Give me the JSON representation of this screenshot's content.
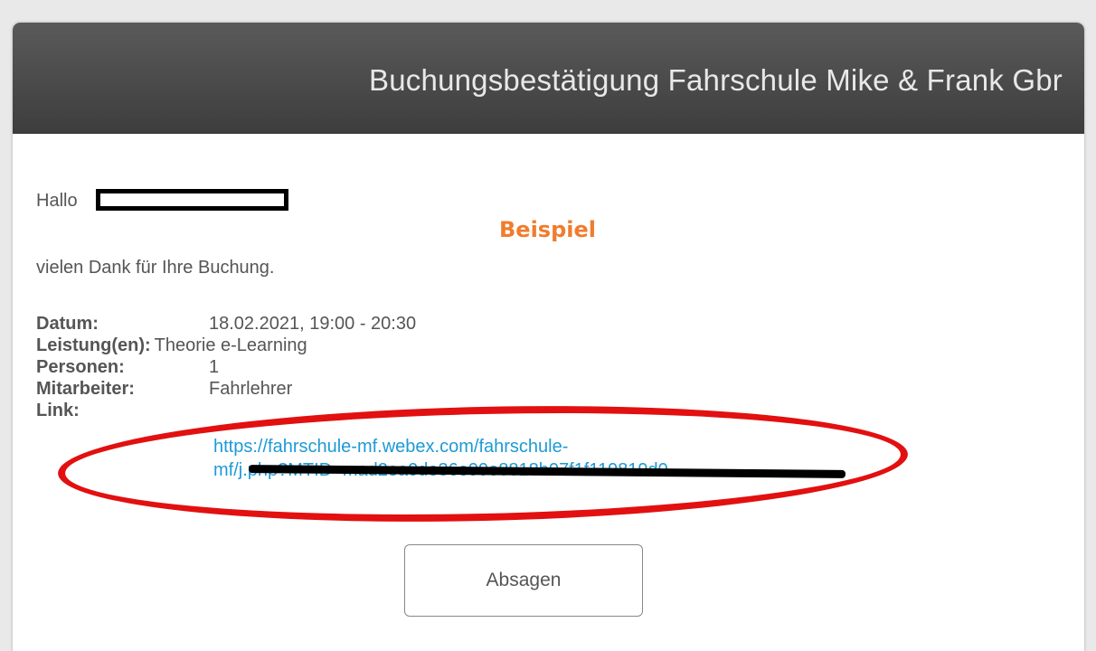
{
  "header": {
    "title": "Buchungsbestätigung Fahrschule Mike & Frank Gbr"
  },
  "greeting": "Hallo",
  "annotation": "Beispiel",
  "thanks": "vielen Dank für Ihre Buchung.",
  "details": {
    "date_label": "Datum:",
    "date_value": "18.02.2021, 19:00 - 20:30",
    "service_label": "Leistung(en):",
    "service_value": "Theorie e-Learning",
    "persons_label": "Personen:",
    "persons_value": "1",
    "staff_label": "Mitarbeiter:",
    "staff_value": "Fahrlehrer",
    "link_label": "Link:",
    "link_line1": "https://fahrschule-mf.webex.com/fahrschule-",
    "link_line2": "mf/j.php?MTID=mad2ea0de36e99e8818b07f1f119819d0"
  },
  "actions": {
    "cancel_label": "Absagen"
  },
  "colors": {
    "header_bg": "#444444",
    "link": "#1e9ad6",
    "annotation": "#f07c2e",
    "highlight_oval": "#e21010"
  }
}
